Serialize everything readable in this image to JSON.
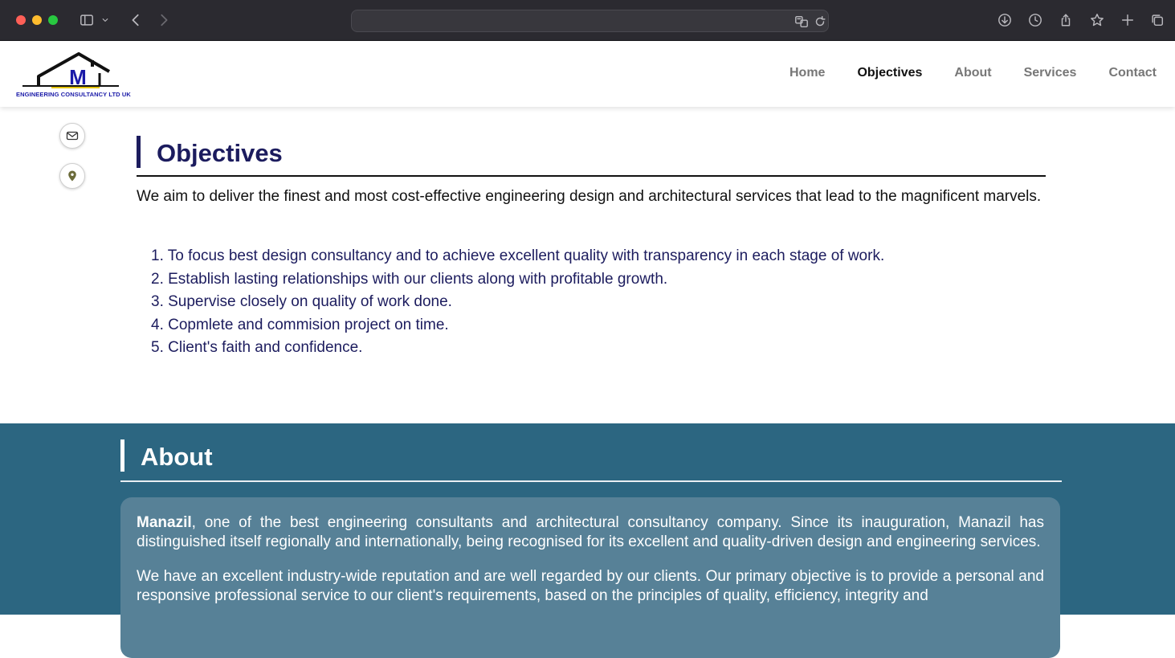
{
  "browser": {
    "address": ""
  },
  "site": {
    "logo_letter": "M",
    "logo_caption": "ENGINEERING CONSULTANCY LTD UK",
    "nav": [
      {
        "label": "Home",
        "active": false
      },
      {
        "label": "Objectives",
        "active": true
      },
      {
        "label": "About",
        "active": false
      },
      {
        "label": "Services",
        "active": false
      },
      {
        "label": "Contact",
        "active": false
      }
    ]
  },
  "objectives": {
    "title": "Objectives",
    "intro": "We aim to deliver the finest and most cost-effective engineering design and architectural services that lead to the magnificent marvels.",
    "items": [
      "1. To focus best design consultancy and to achieve excellent quality with transparency in each stage of work.",
      "2. Establish lasting relationships with our clients along with profitable growth.",
      "3. Supervise closely on quality of work done.",
      "4. Copmlete and commision project on time.",
      "5. Client's faith and confidence."
    ]
  },
  "about": {
    "title": "About",
    "company": "Manazil",
    "para1_rest": ", one of the best engineering consultants and architectural consultancy company. Since its inauguration, Manazil has distinguished itself regionally and internationally, being recognised for its excellent and quality-driven design and engineering services.",
    "para2": "We have an excellent industry-wide reputation and are well regarded by our clients. Our primary objective is to provide a personal and responsive professional service to our client's requirements, based on the principles of quality, efficiency, integrity and"
  },
  "colors": {
    "navy": "#1c1c5e",
    "about_bg": "#2c6681",
    "about_card": "#578197"
  }
}
